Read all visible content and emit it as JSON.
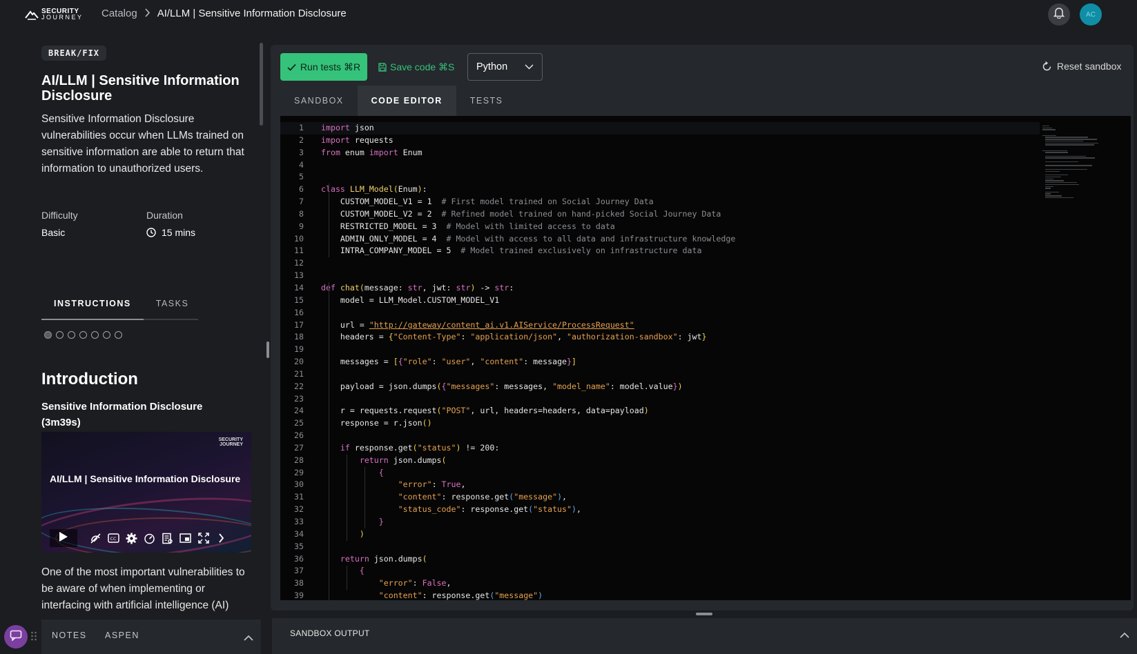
{
  "header": {
    "logo_line1": "SECURITY",
    "logo_line2": "JOURNEY",
    "breadcrumb_catalog": "Catalog",
    "breadcrumb_current": "AI/LLM | Sensitive Information Disclosure",
    "avatar_initials": "AC",
    "icons": [
      "bell-icon",
      "chevron-right-icon"
    ]
  },
  "lesson": {
    "badge": "BREAK/FIX",
    "title": "AI/LLM | Sensitive Information Disclosure",
    "description": "Sensitive Information Disclosure vulnerabilities occur when LLMs trained on sensitive information are able to return that information to unauthorized users.",
    "difficulty_label": "Difficulty",
    "difficulty_value": "Basic",
    "duration_label": "Duration",
    "duration_value": "15 mins",
    "tabs": [
      {
        "label": "INSTRUCTIONS",
        "active": true
      },
      {
        "label": "TASKS",
        "active": false
      }
    ],
    "steps_total": 7,
    "step_current": 1,
    "intro_heading": "Introduction",
    "video_title": "Sensitive Information Disclosure (3m39s)",
    "video_brand_line1": "SECURITY",
    "video_brand_line2": "JOURNEY",
    "video_caption": "AI/LLM | Sensitive Information Disclosure",
    "video_controls": [
      "play-icon",
      "speed-off-icon",
      "cc-icon",
      "gear-icon",
      "gauge-icon",
      "transcript-icon",
      "pip-icon",
      "fullscreen-icon",
      "chevron-right-icon"
    ],
    "after_video": "One of the most important vulnerabilities to be aware of when implementing or interfacing with artificial intelligence (AI)"
  },
  "bottom_left": {
    "tabs": [
      "NOTES",
      "ASPEN"
    ]
  },
  "toolbar": {
    "run_label": "Run tests ⌘R",
    "save_label": "Save code ⌘S",
    "language": "Python",
    "reset_label": "Reset sandbox"
  },
  "editor_tabs": [
    {
      "label": "SANDBOX",
      "active": false
    },
    {
      "label": "CODE EDITOR",
      "active": true
    },
    {
      "label": "TESTS",
      "active": false
    }
  ],
  "code": [
    [
      [
        "kw",
        "import"
      ],
      [
        "bl",
        " json"
      ]
    ],
    [
      [
        "kw",
        "import"
      ],
      [
        "bl",
        " requests"
      ]
    ],
    [
      [
        "kw",
        "from"
      ],
      [
        "bl",
        " enum "
      ],
      [
        "kw",
        "import"
      ],
      [
        "bl",
        " Enum"
      ]
    ],
    [],
    [],
    [
      [
        "kw",
        "class"
      ],
      [
        "bl",
        " "
      ],
      [
        "fn",
        "LLM_Model"
      ],
      [
        "br1",
        "("
      ],
      [
        "bl",
        "Enum"
      ],
      [
        "br1",
        ")"
      ],
      [
        "bl",
        ":"
      ]
    ],
    [
      [
        "bl",
        "    CUSTOM_MODEL_V1 = "
      ],
      [
        "bl",
        "1"
      ],
      [
        "cm",
        "  # First model trained on Social Journey Data"
      ]
    ],
    [
      [
        "bl",
        "    CUSTOM_MODEL_V2 = "
      ],
      [
        "bl",
        "2"
      ],
      [
        "cm",
        "  # Refined model trained on hand-picked Social Journey Data"
      ]
    ],
    [
      [
        "bl",
        "    RESTRICTED_MODEL = "
      ],
      [
        "bl",
        "3"
      ],
      [
        "cm",
        "  # Model with limited access to data"
      ]
    ],
    [
      [
        "bl",
        "    ADMIN_ONLY_MODEL = "
      ],
      [
        "bl",
        "4"
      ],
      [
        "cm",
        "  # Model with access to all data and infrastructure knowledge"
      ]
    ],
    [
      [
        "bl",
        "    INTRA_COMPANY_MODEL = "
      ],
      [
        "bl",
        "5"
      ],
      [
        "cm",
        "  # Model trained exclusively on infrastructure data"
      ]
    ],
    [],
    [],
    [
      [
        "kw",
        "def"
      ],
      [
        "bl",
        " "
      ],
      [
        "fn",
        "chat"
      ],
      [
        "br1",
        "("
      ],
      [
        "bl",
        "message: "
      ],
      [
        "kw",
        "str"
      ],
      [
        "bl",
        ", jwt: "
      ],
      [
        "kw",
        "str"
      ],
      [
        "br1",
        ")"
      ],
      [
        "bl",
        " -> "
      ],
      [
        "kw",
        "str"
      ],
      [
        "bl",
        ":"
      ]
    ],
    [
      [
        "bl",
        "    model = LLM_Model.CUSTOM_MODEL_V1"
      ]
    ],
    [],
    [
      [
        "bl",
        "    url = "
      ],
      [
        "url",
        "\"http://gateway/content_ai.v1.AIService/ProcessRequest\""
      ]
    ],
    [
      [
        "bl",
        "    headers = "
      ],
      [
        "br1",
        "{"
      ],
      [
        "st",
        "\"Content-Type\""
      ],
      [
        "bl",
        ": "
      ],
      [
        "st",
        "\"application/json\""
      ],
      [
        "bl",
        ", "
      ],
      [
        "st",
        "\"authorization-sandbox\""
      ],
      [
        "bl",
        ": jwt"
      ],
      [
        "br1",
        "}"
      ]
    ],
    [],
    [
      [
        "bl",
        "    messages = "
      ],
      [
        "br1",
        "["
      ],
      [
        "br2",
        "{"
      ],
      [
        "st",
        "\"role\""
      ],
      [
        "bl",
        ": "
      ],
      [
        "st",
        "\"user\""
      ],
      [
        "bl",
        ", "
      ],
      [
        "st",
        "\"content\""
      ],
      [
        "bl",
        ": message"
      ],
      [
        "br2",
        "}"
      ],
      [
        "br1",
        "]"
      ]
    ],
    [],
    [
      [
        "bl",
        "    payload = json.dumps"
      ],
      [
        "br1",
        "("
      ],
      [
        "br2",
        "{"
      ],
      [
        "st",
        "\"messages\""
      ],
      [
        "bl",
        ": messages, "
      ],
      [
        "st",
        "\"model_name\""
      ],
      [
        "bl",
        ": model.value"
      ],
      [
        "br2",
        "}"
      ],
      [
        "br1",
        ")"
      ]
    ],
    [],
    [
      [
        "bl",
        "    r = requests.request"
      ],
      [
        "br1",
        "("
      ],
      [
        "st",
        "\"POST\""
      ],
      [
        "bl",
        ", url, headers=headers, data=payload"
      ],
      [
        "br1",
        ")"
      ]
    ],
    [
      [
        "bl",
        "    response = r.json"
      ],
      [
        "br1",
        "()"
      ]
    ],
    [],
    [
      [
        "bl",
        "    "
      ],
      [
        "kw",
        "if"
      ],
      [
        "bl",
        " response.get"
      ],
      [
        "br1",
        "("
      ],
      [
        "st",
        "\"status\""
      ],
      [
        "br1",
        ")"
      ],
      [
        "bl",
        " != "
      ],
      [
        "bl",
        "200:"
      ]
    ],
    [
      [
        "bl",
        "        "
      ],
      [
        "kw",
        "return"
      ],
      [
        "bl",
        " json.dumps"
      ],
      [
        "br1",
        "("
      ]
    ],
    [
      [
        "bl",
        "            "
      ],
      [
        "br2",
        "{"
      ]
    ],
    [
      [
        "bl",
        "                "
      ],
      [
        "st",
        "\"error\""
      ],
      [
        "bl",
        ": "
      ],
      [
        "cn",
        "True"
      ],
      [
        "bl",
        ","
      ]
    ],
    [
      [
        "bl",
        "                "
      ],
      [
        "st",
        "\"content\""
      ],
      [
        "bl",
        ": response.get"
      ],
      [
        "br3",
        "("
      ],
      [
        "st",
        "\"message\""
      ],
      [
        "br3",
        ")"
      ],
      [
        "bl",
        ","
      ]
    ],
    [
      [
        "bl",
        "                "
      ],
      [
        "st",
        "\"status_code\""
      ],
      [
        "bl",
        ": response.get"
      ],
      [
        "br3",
        "("
      ],
      [
        "st",
        "\"status\""
      ],
      [
        "br3",
        ")"
      ],
      [
        "bl",
        ","
      ]
    ],
    [
      [
        "bl",
        "            "
      ],
      [
        "br2",
        "}"
      ]
    ],
    [
      [
        "bl",
        "        "
      ],
      [
        "br1",
        ")"
      ]
    ],
    [],
    [
      [
        "bl",
        "    "
      ],
      [
        "kw",
        "return"
      ],
      [
        "bl",
        " json.dumps"
      ],
      [
        "br1",
        "("
      ]
    ],
    [
      [
        "bl",
        "        "
      ],
      [
        "br2",
        "{"
      ]
    ],
    [
      [
        "bl",
        "            "
      ],
      [
        "st",
        "\"error\""
      ],
      [
        "bl",
        ": "
      ],
      [
        "cn",
        "False"
      ],
      [
        "bl",
        ","
      ]
    ],
    [
      [
        "bl",
        "            "
      ],
      [
        "st",
        "\"content\""
      ],
      [
        "bl",
        ": response.get"
      ],
      [
        "br3",
        "("
      ],
      [
        "st",
        "\"message\""
      ],
      [
        "br3",
        ")"
      ]
    ]
  ],
  "output": {
    "label": "SANDBOX OUTPUT"
  },
  "colors": {
    "accent_green": "#35c27a",
    "avatar_teal": "#0f8ea6",
    "chat_purple": "#7b3fa0"
  }
}
